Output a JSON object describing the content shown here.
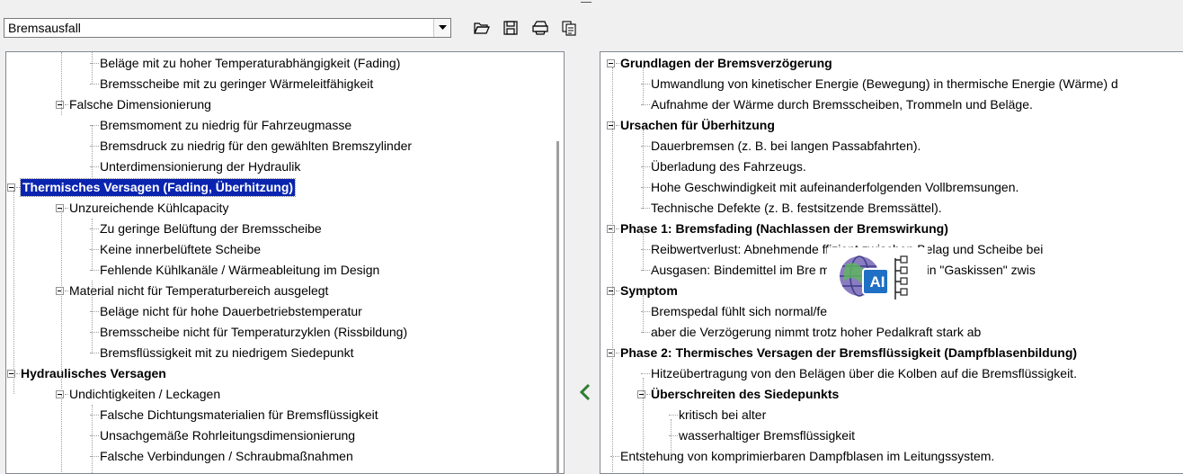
{
  "toolbar": {
    "selected": "Bremsausfall",
    "icons": [
      "folder-open-icon",
      "save-icon",
      "print-icon",
      "export-icon"
    ]
  },
  "left_tree": [
    {
      "label": "Beläge mit zu hoher Temperaturabhängigkeit (Fading)",
      "level": 2,
      "bold": false
    },
    {
      "label": "Bremsscheibe mit zu geringer Wärmeleitfähigkeit",
      "level": 2,
      "bold": false
    },
    {
      "label": "Falsche Dimensionierung",
      "level": 1,
      "bold": false,
      "expander": true
    },
    {
      "label": "Bremsmoment zu niedrig für Fahrzeugmasse",
      "level": 2,
      "bold": false
    },
    {
      "label": "Bremsdruck zu niedrig für den gewählten Bremszylinder",
      "level": 2,
      "bold": false
    },
    {
      "label": "Unterdimensionierung der Hydraulik",
      "level": 2,
      "bold": false
    },
    {
      "label": "Thermisches Versagen (Fading, Überhitzung)",
      "level": 0,
      "bold": true,
      "expander": true,
      "selected": true
    },
    {
      "label": "Unzureichende Kühlcapacity",
      "level": 1,
      "bold": false,
      "expander": true
    },
    {
      "label": "Zu geringe Belüftung der Bremsscheibe",
      "level": 2,
      "bold": false
    },
    {
      "label": "Keine innerbelüftete Scheibe",
      "level": 2,
      "bold": false
    },
    {
      "label": "Fehlende Kühlkanäle / Wärmeableitung im Design",
      "level": 2,
      "bold": false
    },
    {
      "label": "Material nicht für Temperaturbereich ausgelegt",
      "level": 1,
      "bold": false,
      "expander": true
    },
    {
      "label": "Beläge nicht für hohe Dauerbetriebstemperatur",
      "level": 2,
      "bold": false
    },
    {
      "label": "Bremsscheibe nicht für Temperaturzyklen (Rissbildung)",
      "level": 2,
      "bold": false
    },
    {
      "label": "Bremsflüssigkeit mit zu niedrigem Siedepunkt",
      "level": 2,
      "bold": false
    },
    {
      "label": "Hydraulisches Versagen",
      "level": 0,
      "bold": true,
      "expander": true
    },
    {
      "label": "Undichtigkeiten / Leckagen",
      "level": 1,
      "bold": false,
      "expander": true
    },
    {
      "label": "Falsche Dichtungsmaterialien für Bremsflüssigkeit",
      "level": 2,
      "bold": false
    },
    {
      "label": "Unsachgemäße Rohrleitungsdimensionierung",
      "level": 2,
      "bold": false
    },
    {
      "label": "Falsche Verbindungen / Schraubmaßnahmen",
      "level": 2,
      "bold": false
    }
  ],
  "right_tree": [
    {
      "label": "Grundlagen der Bremsverzögerung",
      "level": 0,
      "bold": true,
      "expander": true
    },
    {
      "label": "Umwandlung von kinetischer Energie (Bewegung) in thermische Energie (Wärme) d",
      "level": 1,
      "bold": false
    },
    {
      "label": "Aufnahme der Wärme durch Bremsscheiben, Trommeln und Beläge.",
      "level": 1,
      "bold": false
    },
    {
      "label": "Ursachen für Überhitzung",
      "level": 0,
      "bold": true,
      "expander": true
    },
    {
      "label": "Dauerbremsen (z. B. bei langen Passabfahrten).",
      "level": 1,
      "bold": false
    },
    {
      "label": "Überladung des Fahrzeugs.",
      "level": 1,
      "bold": false
    },
    {
      "label": "Hohe Geschwindigkeit mit aufeinanderfolgenden Vollbremsungen.",
      "level": 1,
      "bold": false
    },
    {
      "label": "Technische Defekte (z. B. festsitzende Bremssättel).",
      "level": 1,
      "bold": false
    },
    {
      "label": "Phase 1: Bremsfading (Nachlassen der Bremswirkung)",
      "level": 0,
      "bold": true,
      "expander": true
    },
    {
      "label": "Reibwertverlust: Abnehmende          ffizient zwischen Belag und Scheibe bei",
      "level": 1,
      "bold": false
    },
    {
      "label": "Ausgasen: Bindemittel im Bre                mpfen und bilden ein \"Gaskissen\"  zwis",
      "level": 1,
      "bold": false
    },
    {
      "label": "Symptom",
      "level": 0,
      "bold": true,
      "expander": true
    },
    {
      "label": "Bremspedal fühlt sich normal/fest an",
      "level": 1,
      "bold": false
    },
    {
      "label": "aber die Verzögerung nimmt trotz hoher Pedalkraft stark ab",
      "level": 1,
      "bold": false
    },
    {
      "label": "Phase 2: Thermisches Versagen der Bremsflüssigkeit (Dampfblasenbildung)",
      "level": 0,
      "bold": true,
      "expander": true
    },
    {
      "label": "Hitzeübertragung von den Belägen über die Kolben auf die Bremsflüssigkeit.",
      "level": 1,
      "bold": false
    },
    {
      "label": "Überschreiten des Siedepunkts",
      "level": 1,
      "bold": true,
      "expander": true
    },
    {
      "label": "kritisch bei alter",
      "level": 2,
      "bold": false
    },
    {
      "label": "wasserhaltiger Bremsflüssigkeit",
      "level": 2,
      "bold": false
    },
    {
      "label": "Entstehung von komprimierbaren Dampfblasen im Leitungssystem.",
      "level": 0,
      "bold": false
    }
  ],
  "badge": {
    "text": "AI"
  },
  "colors": {
    "selection": "#0a24b0",
    "accent": "#2e7d32",
    "badge": "#1f6fc4"
  }
}
